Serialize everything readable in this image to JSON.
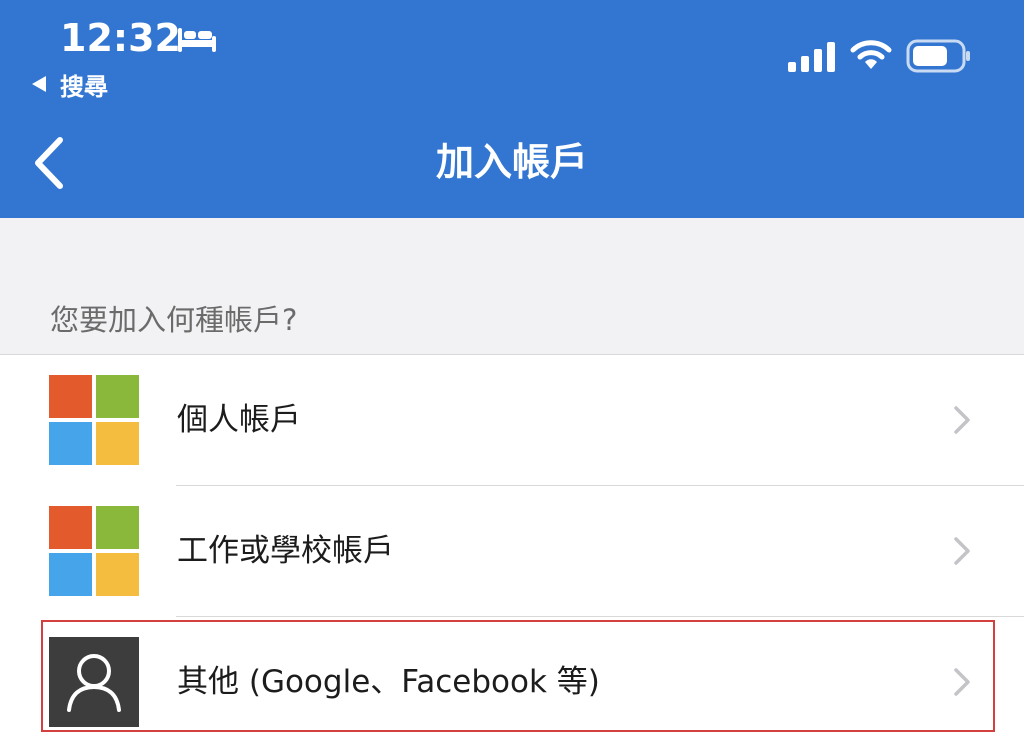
{
  "status_bar": {
    "time": "12:32",
    "back_app_label": "搜尋",
    "icons": [
      "bed-icon",
      "cellular-signal-icon",
      "wifi-icon",
      "battery-icon"
    ]
  },
  "nav": {
    "title": "加入帳戶",
    "back_icon": "chevron-left-icon"
  },
  "section": {
    "prompt": "您要加入何種帳戶?"
  },
  "accounts": [
    {
      "label": "個人帳戶",
      "icon": "microsoft-logo-icon"
    },
    {
      "label": "工作或學校帳戶",
      "icon": "microsoft-logo-icon"
    },
    {
      "label": "其他 (Google、Facebook 等)",
      "icon": "person-icon"
    }
  ],
  "colors": {
    "header_bg": "#3276d1",
    "section_bg": "#f2f2f4",
    "ms_red": "#e35a2d",
    "ms_green": "#8ab83a",
    "ms_blue": "#45a4ea",
    "ms_yellow": "#f5bd3f",
    "highlight": "#d44040"
  }
}
